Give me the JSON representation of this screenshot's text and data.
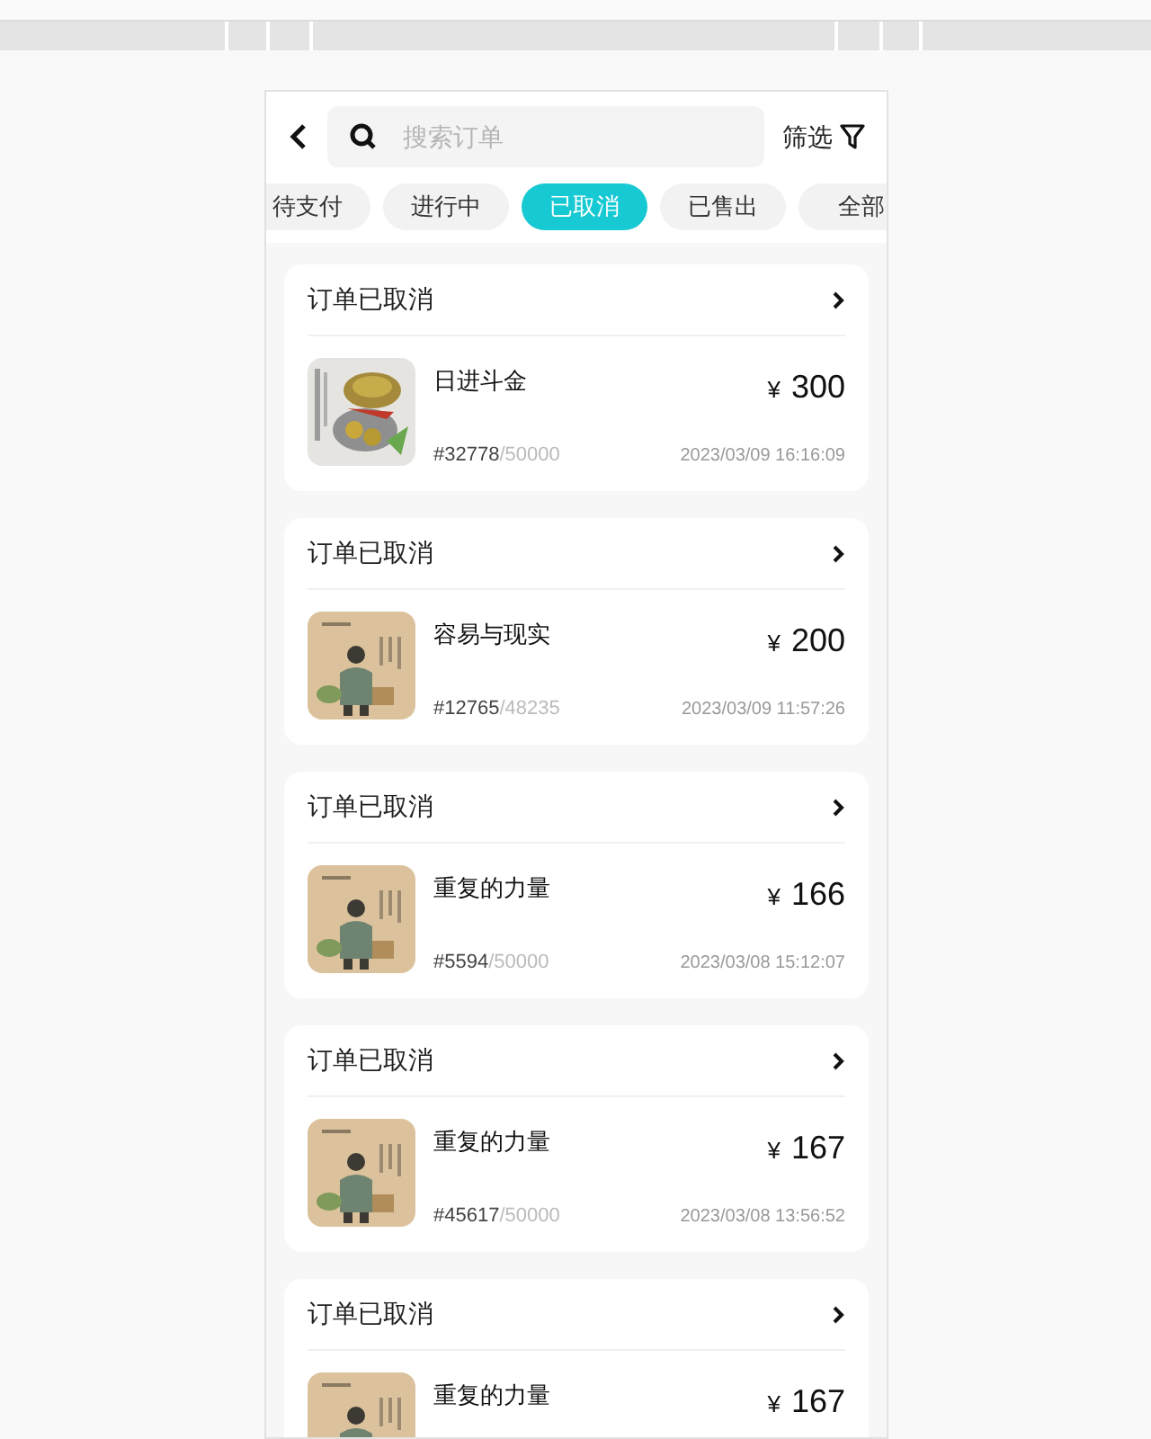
{
  "header": {
    "search": {
      "placeholder": "搜索订单"
    },
    "filter_label": "筛选"
  },
  "tabs": [
    {
      "label": "待支付",
      "selected": false
    },
    {
      "label": "进行中",
      "selected": false
    },
    {
      "label": "已取消",
      "selected": true
    },
    {
      "label": "已售出",
      "selected": false
    },
    {
      "label": "全部",
      "selected": false
    }
  ],
  "orders": [
    {
      "status": "订单已取消",
      "name": "日进斗金",
      "currency": "¥",
      "amount": "300",
      "edition": "#32778",
      "total": "/50000",
      "time": "2023/03/09 16:16:09"
    },
    {
      "status": "订单已取消",
      "name": "容易与现实",
      "currency": "¥",
      "amount": "200",
      "edition": "#12765",
      "total": "/48235",
      "time": "2023/03/09 11:57:26"
    },
    {
      "status": "订单已取消",
      "name": "重复的力量",
      "currency": "¥",
      "amount": "166",
      "edition": "#5594",
      "total": "/50000",
      "time": "2023/03/08 15:12:07"
    },
    {
      "status": "订单已取消",
      "name": "重复的力量",
      "currency": "¥",
      "amount": "167",
      "edition": "#45617",
      "total": "/50000",
      "time": "2023/03/08 13:56:52"
    },
    {
      "status": "订单已取消",
      "name": "重复的力量",
      "currency": "¥",
      "amount": "167"
    }
  ]
}
